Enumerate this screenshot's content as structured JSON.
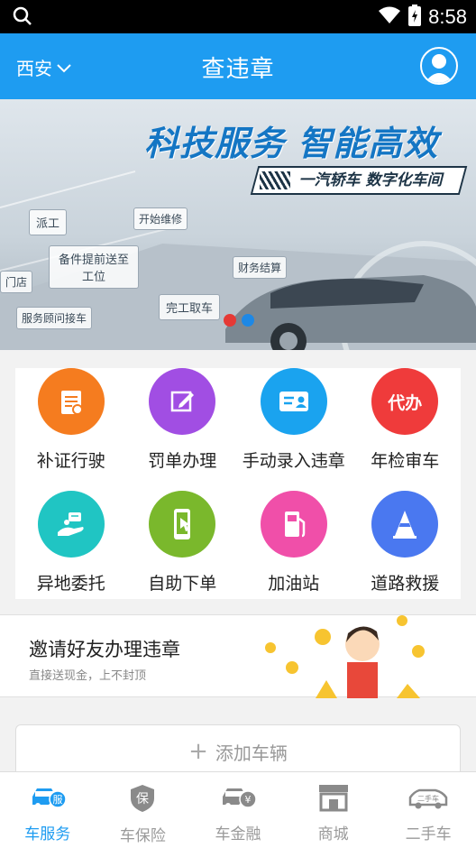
{
  "status": {
    "time": "8:58"
  },
  "appbar": {
    "city": "西安",
    "title": "查违章"
  },
  "banner": {
    "headline": "科技服务 智能高效",
    "subline": "一汽轿车 数字化车间",
    "chips": [
      "派工",
      "开始维修",
      "备件提前送至工位",
      "财务结算",
      "完工取车",
      "服务顾问接车",
      "门店"
    ]
  },
  "services": [
    {
      "label": "补证行驶",
      "color": "#f57c1f",
      "icon": "document-icon"
    },
    {
      "label": "罚单办理",
      "color": "#a14ee3",
      "icon": "edit-icon"
    },
    {
      "label": "手动录入违章",
      "color": "#1aa3ef",
      "icon": "id-card-icon"
    },
    {
      "label": "年检审车",
      "color": "#ef3b3b",
      "icon": "proxy-icon",
      "glyph": "代办"
    },
    {
      "label": "异地委托",
      "color": "#20c5c3",
      "icon": "hand-delegate-icon"
    },
    {
      "label": "自助下单",
      "color": "#7ab82c",
      "icon": "phone-tap-icon"
    },
    {
      "label": "加油站",
      "color": "#f04fa9",
      "icon": "fuel-pump-icon"
    },
    {
      "label": "道路救援",
      "color": "#4a78f0",
      "icon": "traffic-cone-icon"
    }
  ],
  "invite": {
    "title": "邀请好友办理违章",
    "subtitle": "直接送现金，上不封顶"
  },
  "add_vehicle": {
    "label": "添加车辆"
  },
  "tabs": [
    {
      "label": "车服务",
      "icon": "car-service-icon",
      "glyph": "服"
    },
    {
      "label": "车保险",
      "icon": "insurance-shield-icon",
      "glyph": "保"
    },
    {
      "label": "车金融",
      "icon": "car-finance-icon",
      "glyph": "¥"
    },
    {
      "label": "商城",
      "icon": "store-icon"
    },
    {
      "label": "二手车",
      "icon": "used-car-icon",
      "glyph": "二手车"
    }
  ],
  "colors": {
    "primary": "#1e9cf1",
    "dot_active": "#e53935",
    "dot_inactive": "#1e88e5"
  }
}
